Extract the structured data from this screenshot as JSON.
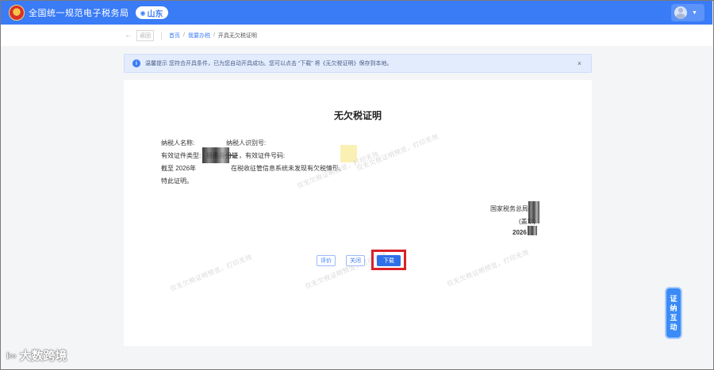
{
  "header": {
    "site_title": "全国统一规范电子税务局",
    "region": "山东",
    "region_icon": "location-pin-icon"
  },
  "breadcrumb": {
    "back_label": "返回",
    "items": [
      "首页",
      "我要办税",
      "开具无欠税证明"
    ]
  },
  "alert": {
    "text": "温馨提示 您符合开具条件，已为您自动开具成功。您可以点击 “下载” 将《无欠税证明》保存到本地。",
    "close": "×"
  },
  "certificate": {
    "title": "无欠税证明",
    "taxpayer_name_label": "纳税人名称:",
    "taxpayer_id_label": "纳税人识别号:",
    "id_type_label": "有效证件类型:",
    "id_type_value": "居民身份证",
    "id_number_label": "，有效证件号码:",
    "as_of": "截至 2026年",
    "statement": "在税收征管信息系统未发现有欠税情形。",
    "hereby": "特此证明。",
    "issuer": "国家税务总局",
    "seal_note": "(盖章)",
    "date": "2026"
  },
  "watermark_text": "仅无欠税证明预览，打印无效",
  "buttons": {
    "evaluate": "评价",
    "close": "关闭",
    "download": "下载"
  },
  "side_button": [
    "证",
    "纳",
    "互",
    "动"
  ],
  "brand": {
    "mark": "ℓ∞",
    "name": "大数跨境"
  },
  "colors": {
    "primary": "#3a7bf6",
    "highlight": "#d9222a"
  }
}
